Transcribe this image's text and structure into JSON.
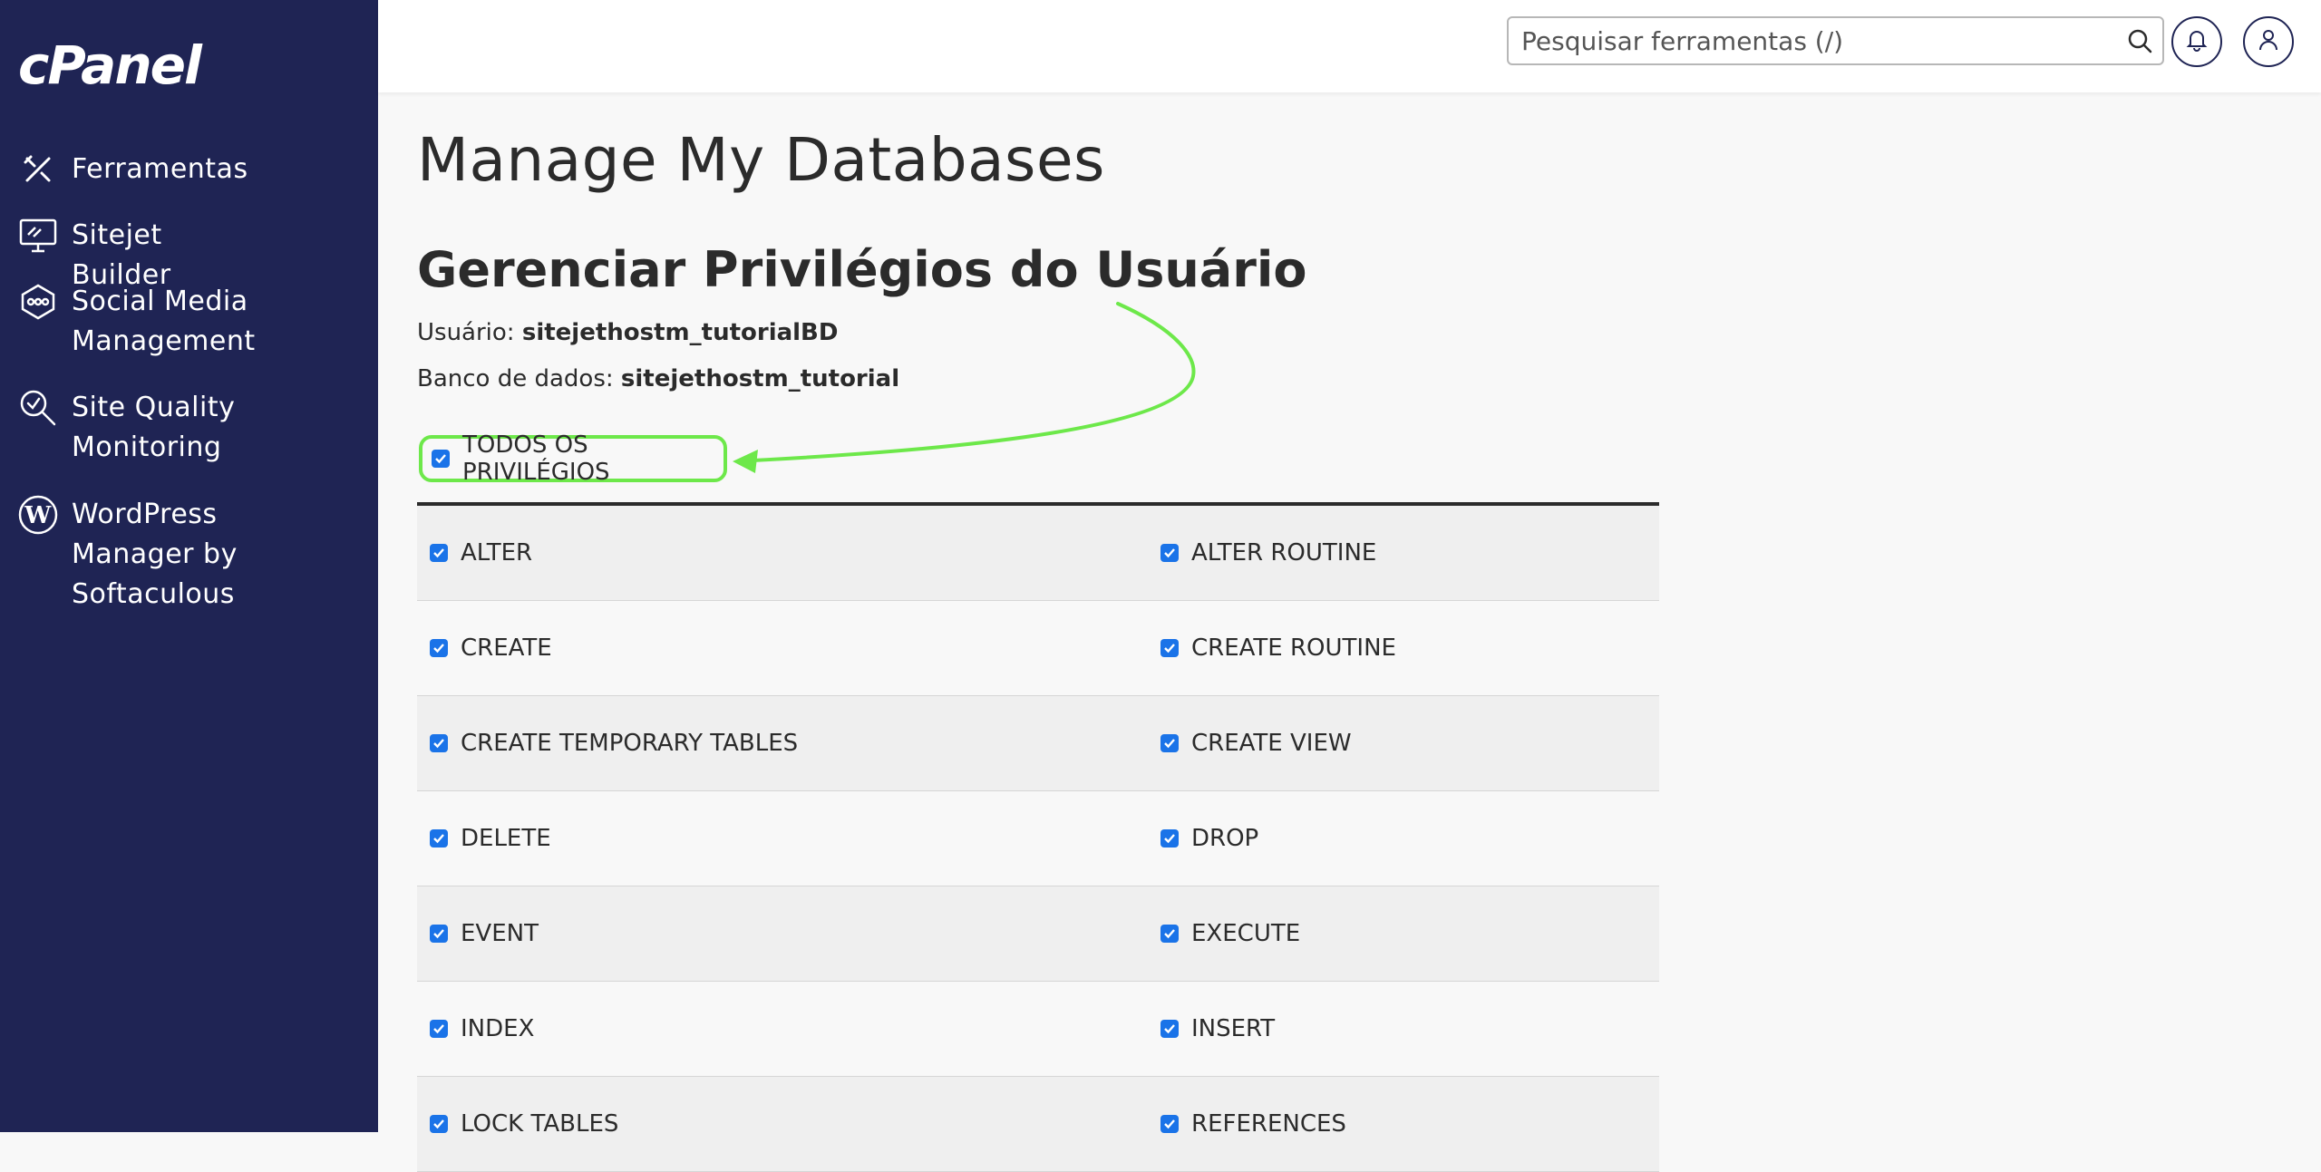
{
  "app": {
    "logo_text": "cPanel"
  },
  "sidebar": {
    "items": [
      {
        "label": "Ferramentas",
        "icon": "tools-icon"
      },
      {
        "label": "Sitejet Builder",
        "icon": "monitor-icon"
      },
      {
        "label": "Social Media Management",
        "icon": "social-icon"
      },
      {
        "label": "Site Quality Monitoring",
        "icon": "search-check-icon"
      },
      {
        "label": "WordPress Manager by Softaculous",
        "icon": "wordpress-icon"
      }
    ]
  },
  "header": {
    "search_placeholder": "Pesquisar ferramentas (/)",
    "search_icon": "search-icon",
    "notifications_icon": "bell-icon",
    "user_icon": "user-icon"
  },
  "main": {
    "page_title": "Manage My Databases",
    "section_title": "Gerenciar Privilégios do Usuário",
    "user_label": "Usuário:",
    "user_value": "sitejethostm_tutorialBD",
    "db_label": "Banco de dados:",
    "db_value": "sitejethostm_tutorial",
    "all_privileges_label": "TODOS OS PRIVILÉGIOS",
    "privileges": [
      [
        "ALTER",
        "ALTER ROUTINE"
      ],
      [
        "CREATE",
        "CREATE ROUTINE"
      ],
      [
        "CREATE TEMPORARY TABLES",
        "CREATE VIEW"
      ],
      [
        "DELETE",
        "DROP"
      ],
      [
        "EVENT",
        "EXECUTE"
      ],
      [
        "INDEX",
        "INSERT"
      ],
      [
        "LOCK TABLES",
        "REFERENCES"
      ]
    ]
  },
  "colors": {
    "sidebar_bg": "#1f2454",
    "checkbox_blue": "#1a73e8",
    "annotation_green": "#6de84a"
  }
}
